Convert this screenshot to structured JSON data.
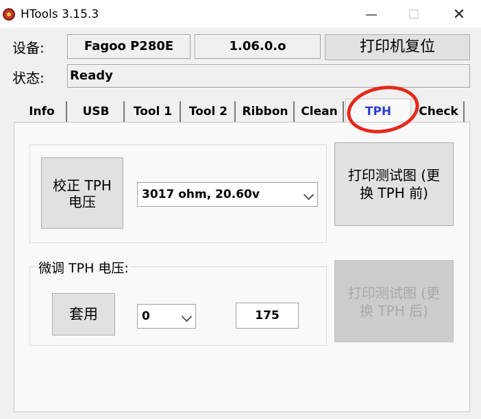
{
  "window": {
    "title": "HTools  3.15.3",
    "minimize_glyph": "—",
    "maximize_glyph": "☐",
    "close_glyph": "✕"
  },
  "device": {
    "label": "设备:",
    "model": "Fagoo P280E",
    "version": "1.06.0.o",
    "reset_button": "打印机复位"
  },
  "status": {
    "label": "状态:",
    "value": "Ready"
  },
  "tabs": [
    {
      "label": "Info"
    },
    {
      "label": "USB"
    },
    {
      "label": "Tool 1"
    },
    {
      "label": "Tool 2"
    },
    {
      "label": "Ribbon"
    },
    {
      "label": "Clean"
    },
    {
      "label": "TPH",
      "active": true
    },
    {
      "label": "Check"
    }
  ],
  "tph": {
    "calibrate_button_line1": "校正 TPH",
    "calibrate_button_line2": "电压",
    "voltage_select_value": "3017 ohm,  20.60v",
    "print_before_line1": "打印测试图 (更",
    "print_before_line2": "换 TPH 前)",
    "fine_tune_label": "微调 TPH 电压:",
    "apply_button": "套用",
    "offset_select_value": "0",
    "value_field": "175",
    "print_after_line1": "打印测试图 (更",
    "print_after_line2": "换 TPH 后)"
  },
  "colors": {
    "active_tab_text": "#2b3fd3",
    "annotation_circle": "#e5281b"
  }
}
